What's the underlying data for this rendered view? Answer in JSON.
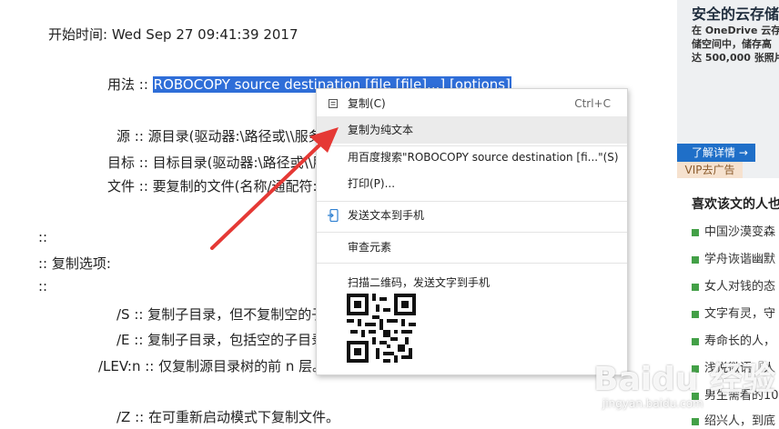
{
  "document": {
    "start_time": "开始时间: Wed Sep 27 09:41:39 2017",
    "usage_prefix": "用法 :: ",
    "usage_selected": "ROBOCOPY source destination [file [file]...] [options]",
    "source_line": "源 :: 源目录(驱动器:\\路径或\\\\服务器\\共享\\路径)。",
    "dest_line": "目标 :: 目标目录(驱动器:\\路径或\\\\服务器\\共享\\路径)。",
    "file_line": "文件 :: 要复制的文件(名称/通配符: 默认为 \"*.*\")。",
    "colons1": "::",
    "copy_options": ":: 复制选项:",
    "colons2": "::",
    "opt_s": "/S :: 复制子目录，但不复制空的子目录。",
    "opt_e": "/E :: 复制子目录，包括空的子目录。",
    "opt_lev": "/LEV:n :: 仅复制源目录树的前 n 层。",
    "opt_z": "/Z :: 在可重新启动模式下复制文件。"
  },
  "context_menu": {
    "copy": "复制(C)",
    "copy_shortcut": "Ctrl+C",
    "copy_plain": "复制为纯文本",
    "baidu_search": "用百度搜索\"ROBOCOPY source destination [fi...\"(S)",
    "print": "打印(P)...",
    "send_to_phone": "发送文本到手机",
    "inspect": "审查元素",
    "scan_qr": "扫描二维码，发送文字到手机"
  },
  "sidebar": {
    "ad_title": "安全的云存储",
    "ad_desc_line1": "在 OneDrive 云存",
    "ad_desc_line2": "储空间中，储存高",
    "ad_desc_line3": "达 500,000 张照片",
    "ad_button": "了解详情 →",
    "vip": "VIP去广告",
    "related_heading": "喜欢该文的人也",
    "related": [
      "中国沙漠变森",
      "学舟诙谐幽默",
      "女人对钱的态",
      "文字有灵，守",
      "寿命长的人，",
      "浅说微语『人",
      "男生需看的10",
      "绍兴人，到底"
    ]
  },
  "watermark": {
    "logo": "Baidu 经验",
    "url": "jingyan.baidu.com"
  },
  "colors": {
    "selection": "#2f6ed8",
    "arrow": "#e53935",
    "ad_button": "#1f6fc8",
    "bullet": "#43a047"
  }
}
